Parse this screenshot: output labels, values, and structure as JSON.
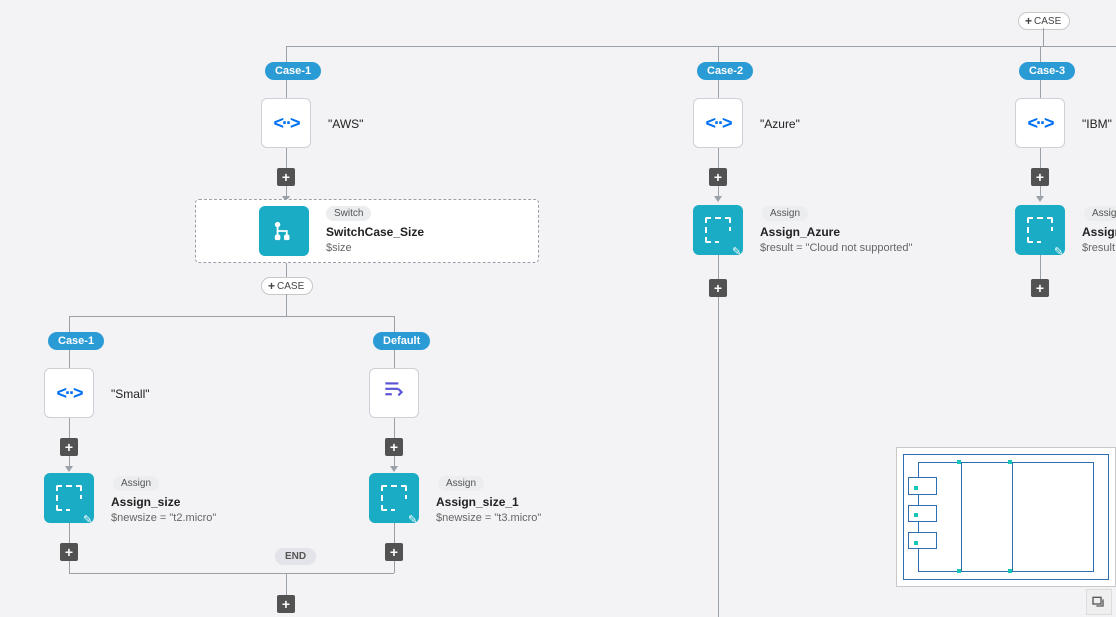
{
  "top": {
    "add_case_label": "CASE",
    "case1": "Case-1",
    "case2": "Case-2",
    "case3": "Case-3"
  },
  "aws": {
    "value": "\"AWS\"",
    "switch_type": "Switch",
    "switch_name": "SwitchCase_Size",
    "switch_expr": "$size",
    "add_case_label": "CASE"
  },
  "azure": {
    "value": "\"Azure\"",
    "assign_type": "Assign",
    "assign_name": "Assign_Azure",
    "assign_expr": "$result = \"Cloud not supported\""
  },
  "ibm": {
    "value": "\"IBM\"",
    "assign_type": "Assign",
    "assign_name": "Assign_IBM",
    "assign_expr": "$result"
  },
  "size": {
    "case1": "Case-1",
    "default": "Default",
    "small_value": "\"Small\"",
    "end_label": "END",
    "assign_type": "Assign",
    "size1_name": "Assign_size",
    "size1_expr": "$newsize = \"t2.micro\"",
    "size2_name": "Assign_size_1",
    "size2_expr": "$newsize = \"t3.micro\""
  }
}
